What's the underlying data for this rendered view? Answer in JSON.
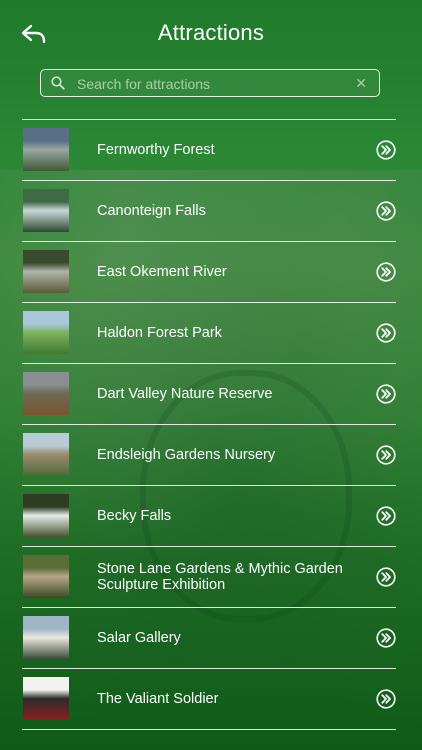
{
  "header": {
    "title": "Attractions",
    "back_icon": "back-arrow-icon"
  },
  "search": {
    "placeholder": "Search for attractions",
    "value": "",
    "search_icon": "search-icon",
    "clear_icon": "clear-icon",
    "clear_glyph": "✕"
  },
  "attractions": [
    {
      "name": "Fernworthy Forest",
      "thumb_colors": [
        "#5a6f86",
        "#9aa7a0",
        "#3e5a37"
      ]
    },
    {
      "name": "Canonteign Falls",
      "thumb_colors": [
        "#3e6b45",
        "#c9d8d6",
        "#2d4a31"
      ]
    },
    {
      "name": "East Okement River",
      "thumb_colors": [
        "#3a4a2e",
        "#b0b5a8",
        "#5b5a3a"
      ]
    },
    {
      "name": "Haldon Forest Park",
      "thumb_colors": [
        "#a9c6db",
        "#7eb25f",
        "#3f7a2f"
      ]
    },
    {
      "name": "Dart Valley Nature Reserve",
      "thumb_colors": [
        "#8a8f92",
        "#6d6a52",
        "#7a5533"
      ]
    },
    {
      "name": "Endsleigh Gardens Nursery",
      "thumb_colors": [
        "#b9cbd4",
        "#9a8b6e",
        "#4d6a36"
      ]
    },
    {
      "name": "Becky Falls",
      "thumb_colors": [
        "#2e3d22",
        "#e6ece8",
        "#47522f"
      ]
    },
    {
      "name": "Stone Lane Gardens & Mythic Garden Sculpture Exhibition",
      "thumb_colors": [
        "#5b6e3a",
        "#b9a68a",
        "#3a4a24"
      ]
    },
    {
      "name": "Salar Gallery",
      "thumb_colors": [
        "#9fb6c8",
        "#ece8e0",
        "#3b4b3a"
      ]
    },
    {
      "name": "The Valiant Soldier",
      "thumb_colors": [
        "#f2f2f0",
        "#2b2b2b",
        "#8b1f1f"
      ]
    }
  ],
  "row_action_icon": "chevron-right-double-circle-icon",
  "colors": {
    "background_top": "#1f7a2a",
    "background_bottom": "#0f5a17",
    "text": "#ffffff",
    "divider": "#ffffff"
  }
}
